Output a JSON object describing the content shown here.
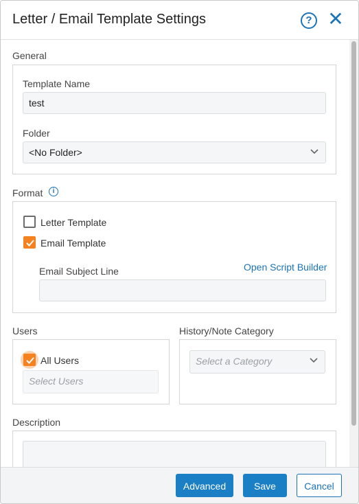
{
  "dialog": {
    "title": "Letter / Email Template Settings",
    "help_icon": "help-circle-icon",
    "close_icon": "close-icon"
  },
  "general": {
    "section_label": "General",
    "template_name_label": "Template Name",
    "template_name_value": "test",
    "folder_label": "Folder",
    "folder_value": "<No Folder>"
  },
  "format": {
    "section_label": "Format",
    "info_icon": "info-icon",
    "letter_template_label": "Letter Template",
    "letter_template_checked": false,
    "email_template_label": "Email Template",
    "email_template_checked": true,
    "email_subject_label": "Email Subject Line",
    "email_subject_value": "",
    "open_script_builder": "Open Script Builder"
  },
  "users": {
    "section_label": "Users",
    "all_users_label": "All Users",
    "all_users_checked": true,
    "select_users_placeholder": "Select Users"
  },
  "history": {
    "section_label": "History/Note Category",
    "category_placeholder": "Select a Category"
  },
  "description": {
    "section_label": "Description"
  },
  "footer": {
    "advanced": "Advanced",
    "save": "Save",
    "cancel": "Cancel"
  },
  "colors": {
    "accent": "#1a73b8",
    "checkbox_checked": "#f58220",
    "primary_button": "#1a7fc4"
  }
}
